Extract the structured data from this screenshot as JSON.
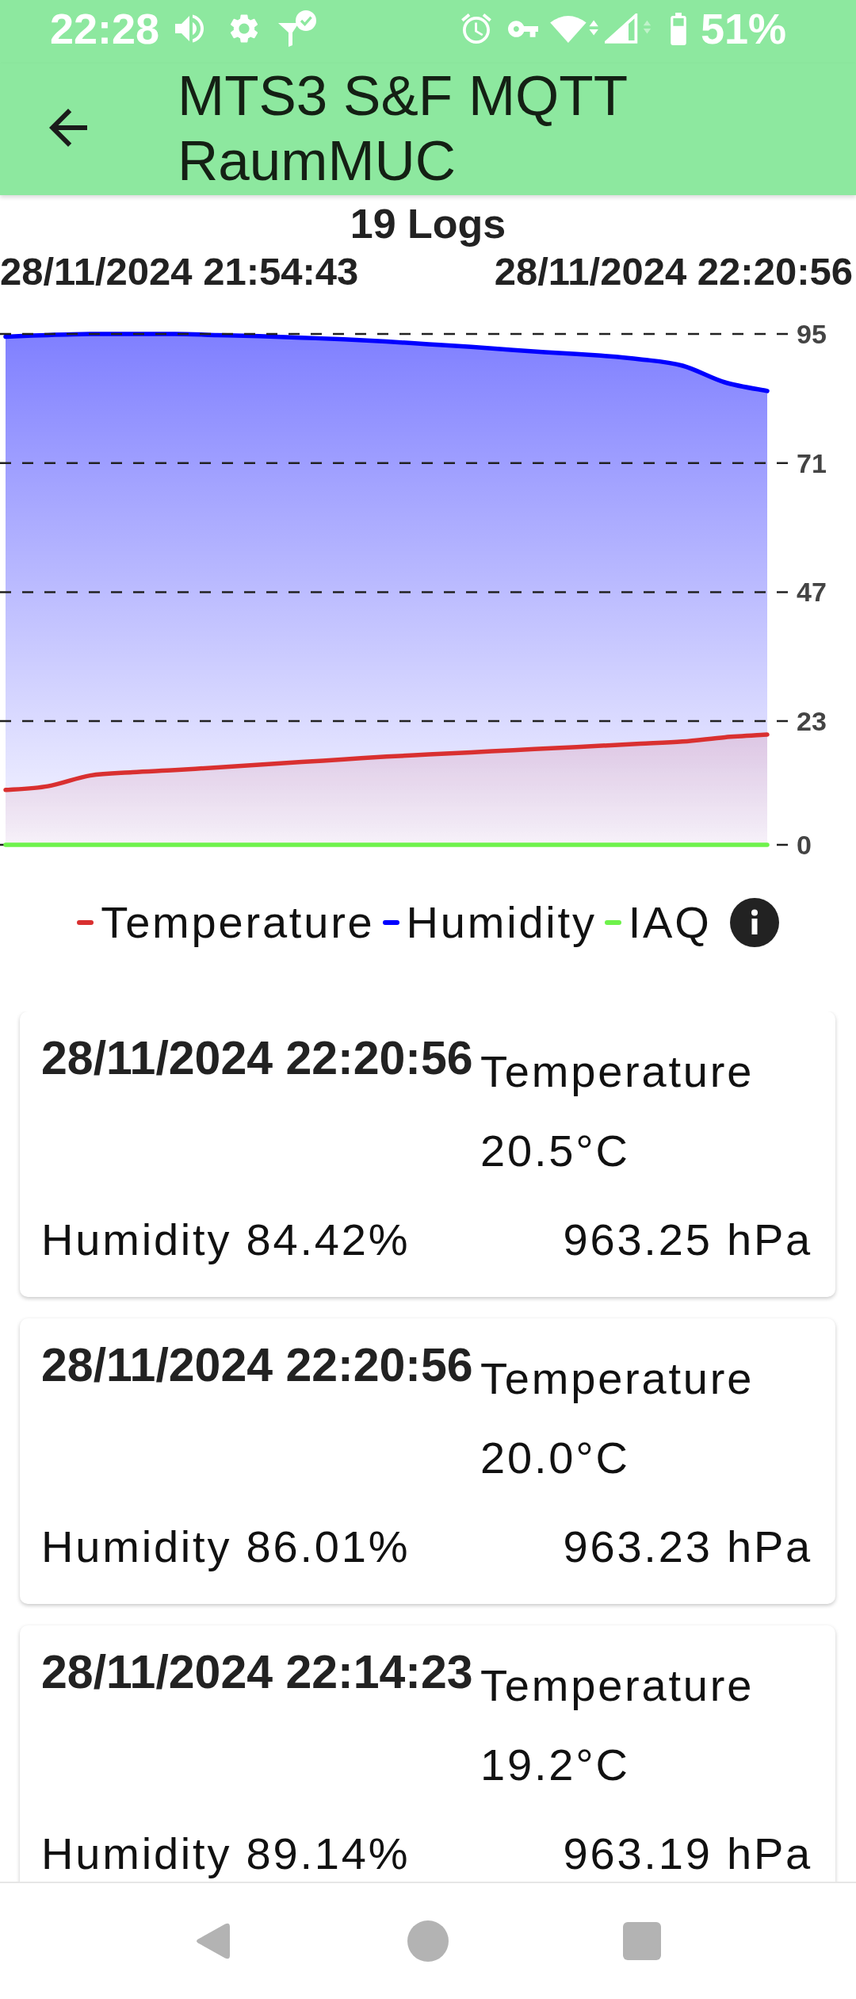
{
  "status_bar": {
    "time": "22:28",
    "battery": "51%"
  },
  "app_bar": {
    "title": "MTS3 S&F MQTT RaumMUC"
  },
  "log_count": "19 Logs",
  "range": {
    "start": "28/11/2024 21:54:43",
    "end": "28/11/2024 22:20:56"
  },
  "chart": {
    "chart_data": {
      "type": "area",
      "series": [
        {
          "name": "Temperature",
          "color": "#d93030",
          "values": [
            10.2,
            10.9,
            12.9,
            13.5,
            13.9,
            14.4,
            14.9,
            15.4,
            15.9,
            16.4,
            16.8,
            17.2,
            17.6,
            18.0,
            18.4,
            18.8,
            19.2,
            20.0,
            20.5
          ]
        },
        {
          "name": "Humidity",
          "color": "#0000ff",
          "values": [
            94.5,
            94.8,
            95.0,
            95.0,
            95.0,
            94.8,
            94.6,
            94.3,
            94.0,
            93.6,
            93.1,
            92.6,
            92.0,
            91.5,
            91.0,
            90.3,
            89.1,
            86.0,
            84.4
          ]
        },
        {
          "name": "IAQ",
          "type": "line",
          "color": "#6ef24b",
          "values": [
            0,
            0,
            0,
            0,
            0,
            0,
            0,
            0,
            0,
            0,
            0,
            0,
            0,
            0,
            0,
            0,
            0,
            0,
            0
          ]
        }
      ],
      "ylim": [
        0,
        95
      ],
      "yticks": [
        0,
        23,
        47,
        71,
        95
      ],
      "grid": true
    }
  },
  "logs": [
    {
      "timestamp": "28/11/2024 22:20:56",
      "temperature_label": "Temperature",
      "temperature": "20.5°C",
      "humidity": "Humidity 84.42%",
      "pressure": "963.25 hPa"
    },
    {
      "timestamp": "28/11/2024 22:20:56",
      "temperature_label": "Temperature",
      "temperature": "20.0°C",
      "humidity": "Humidity 86.01%",
      "pressure": "963.23 hPa"
    },
    {
      "timestamp": "28/11/2024 22:14:23",
      "temperature_label": "Temperature",
      "temperature": "19.2°C",
      "humidity": "Humidity 89.14%",
      "pressure": "963.19 hPa"
    }
  ]
}
